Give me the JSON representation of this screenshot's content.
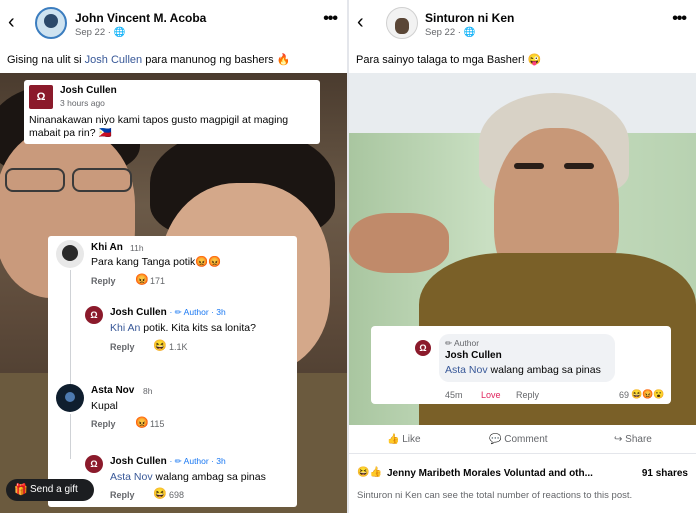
{
  "left": {
    "header": {
      "author": "John Vincent M. Acoba",
      "date": "Sep 22",
      "privacy_icon": "globe-icon"
    },
    "caption": {
      "text_before": "Gising na ulit si ",
      "tag": "Josh Cullen",
      "text_after": " para manunog ng bashers 🔥"
    },
    "post_card": {
      "name": "Josh Cullen",
      "time": "3 hours ago",
      "line1": "Ninanakawan niyo kami tapos gusto magpigil at maging",
      "line2": "mabait pa rin? 🇵🇭"
    },
    "comments": [
      {
        "name": "Khi An",
        "time": "11h",
        "text": "Para kang Tanga potik😡😡",
        "reply": "Reply",
        "reactions": "😡",
        "count": "171"
      },
      {
        "name": "Josh Cullen",
        "badge": "· ✏ Author · 3h",
        "mention": "Khi An",
        "text": " potik. Kita kits sa lonita?",
        "reply": "Reply",
        "reactions": "😆",
        "count": "1.1K"
      },
      {
        "name": "Asta Nov",
        "time": "8h",
        "text": "Kupal",
        "reply": "Reply",
        "reactions": "😡",
        "count": "115"
      },
      {
        "name": "Josh Cullen",
        "badge": "· ✏ Author · 3h",
        "mention": "Asta Nov",
        "text": " walang ambag sa pinas",
        "reply": "Reply",
        "reactions": "😆",
        "count": "698"
      }
    ],
    "gift_button": "Send a gift"
  },
  "right": {
    "header": {
      "author": "Sinturon ni Ken",
      "date": "Sep 22",
      "privacy_icon": "globe-icon"
    },
    "caption": "Para sainyo talaga to mga Basher! 😜",
    "comment_card": {
      "badge": "✏ Author",
      "name": "Josh Cullen",
      "mention": "Asta Nov",
      "text": " walang ambag sa pinas",
      "time": "45m",
      "love": "Love",
      "reply": "Reply",
      "count": "69",
      "reactions": "😆😡😮"
    },
    "actions": {
      "like": "Like",
      "comment": "Comment",
      "share": "Share"
    },
    "reactions_summary": {
      "icons": "😆👍",
      "names": "Jenny Maribeth Morales Voluntad and oth...",
      "shares": "91 shares"
    },
    "note": "Sinturon ni Ken can see the total number of reactions to this post."
  }
}
